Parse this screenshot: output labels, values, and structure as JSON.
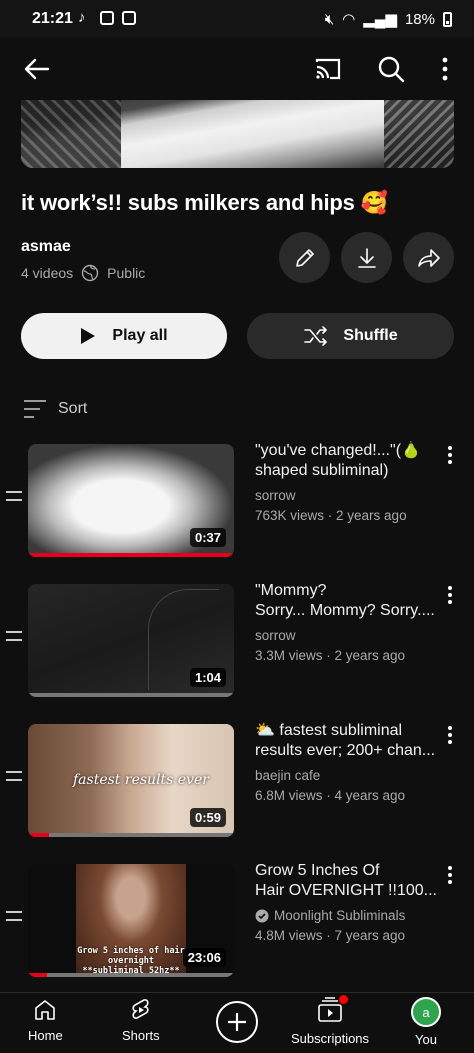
{
  "status_bar": {
    "time": "21:21",
    "battery": "18%"
  },
  "playlist": {
    "title": "it work’s!! subs milkers and hips 🥰",
    "owner": "asmae",
    "video_count": "4 videos",
    "privacy": "Public"
  },
  "actions": {
    "play_all": "Play all",
    "shuffle": "Shuffle",
    "sort": "Sort"
  },
  "videos": [
    {
      "title_line1": "\"you've changed!...\"(🍐",
      "title_line2": "shaped subliminal)",
      "channel": "sorrow",
      "verified": false,
      "stats": "763K views · 2 years ago",
      "duration": "0:37",
      "progress": 1.0
    },
    {
      "title_line1": "\"Mommy?",
      "title_line2": "Sorry... Mommy? Sorry....",
      "channel": "sorrow",
      "verified": false,
      "stats": "3.3M views · 2 years ago",
      "duration": "1:04",
      "progress": 0.0
    },
    {
      "title_line1": "⛅ fastest subliminal",
      "title_line2": "results ever; 200+ chan...",
      "channel": "baejin cafe",
      "verified": false,
      "stats": "6.8M views · 4 years ago",
      "duration": "0:59",
      "progress": 0.1,
      "thumb_text": "fastest results ever"
    },
    {
      "title_line1": "Grow 5 Inches Of",
      "title_line2": "Hair OVERNIGHT !!100...",
      "channel": "Moonlight Subliminals",
      "verified": true,
      "stats": "4.8M views · 7 years ago",
      "duration": "23:06",
      "progress": 0.09,
      "thumb_text": "Grow 5 inches of hair overnight **subliminal 52hz**"
    }
  ],
  "nav": {
    "home": "Home",
    "shorts": "Shorts",
    "subscriptions": "Subscriptions",
    "you": "You",
    "avatar_letter": "a"
  },
  "colors": {
    "background": "#0f0f0f",
    "progress": "#e5001b",
    "avatar": "#2ea44f"
  }
}
